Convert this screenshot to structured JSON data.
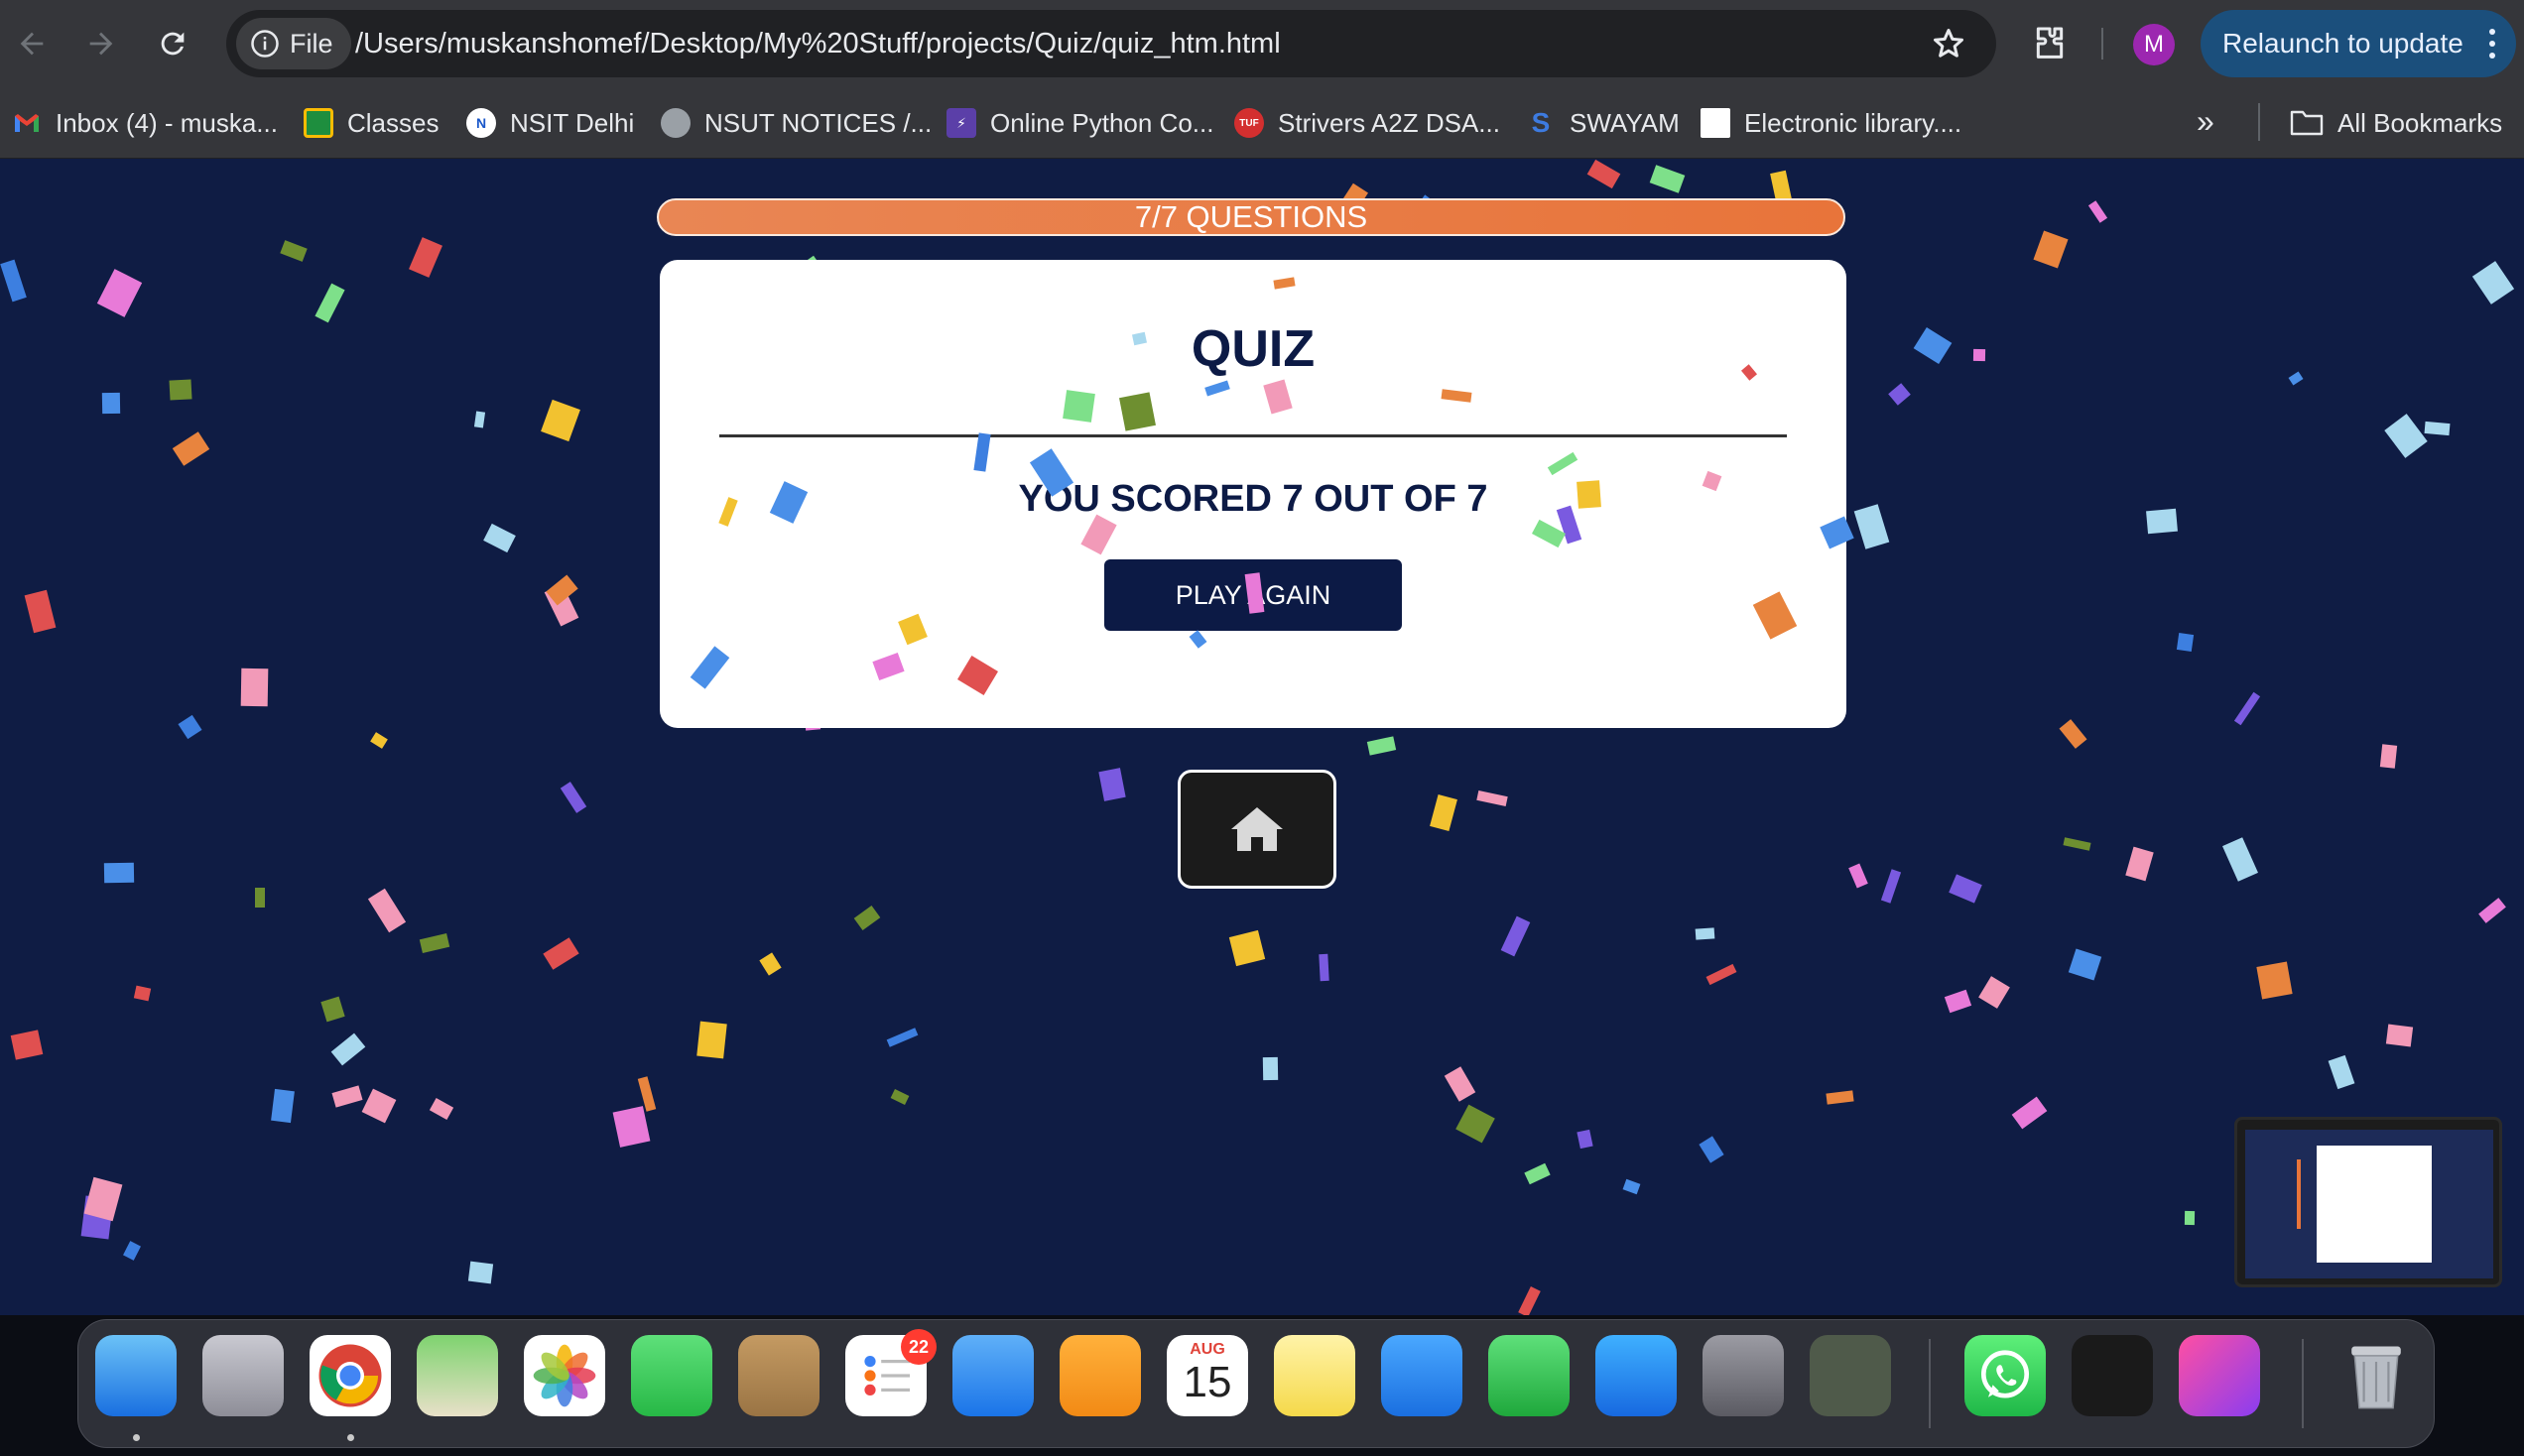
{
  "browser": {
    "site_chip": "File",
    "url": "/Users/muskanshomef/Desktop/My%20Stuff/projects/Quiz/quiz_htm.html",
    "avatar_letter": "M",
    "relaunch_label": "Relaunch to update",
    "accent_color": "#1b4f7c"
  },
  "bookmarks": {
    "items": [
      {
        "label": "Inbox (4) - muska...",
        "icon": "gmail-icon"
      },
      {
        "label": "Classes",
        "icon": "classroom-icon"
      },
      {
        "label": "NSIT Delhi",
        "icon": "nsit-icon"
      },
      {
        "label": "NSUT NOTICES /...",
        "icon": "globe-icon"
      },
      {
        "label": "Online Python Co...",
        "icon": "bolt-icon"
      },
      {
        "label": "Strivers A2Z DSA...",
        "icon": "tuf-icon"
      },
      {
        "label": "SWAYAM",
        "icon": "swayam-icon"
      },
      {
        "label": "Electronic library....",
        "icon": "page-icon"
      }
    ],
    "overflow": "»",
    "all_bookmarks": "All Bookmarks"
  },
  "quiz": {
    "progress_label": "7/7 QUESTIONS",
    "progress_fraction": 1.0,
    "title": "QUIZ",
    "score_text": "YOU SCORED 7 OUT OF 7",
    "play_again_label": "PLAY AGAIN",
    "home_icon": "home-icon",
    "colors": {
      "background": "#0f1c44",
      "primary": "#0c1a45",
      "progress": "#e8743a"
    }
  },
  "dock": {
    "apps": [
      "Finder",
      "Launchpad",
      "Google Chrome",
      "Maps",
      "Photos",
      "FaceTime",
      "Contacts",
      "Reminders",
      "Mail",
      "Pages",
      "Calendar",
      "Notes",
      "Keynote",
      "Numbers",
      "App Store",
      "System Settings",
      "Chip",
      "WhatsApp",
      "Webex",
      "WPS Office",
      "Trash"
    ],
    "reminders_badge": "22",
    "calendar_month": "AUG",
    "calendar_day": "15"
  }
}
